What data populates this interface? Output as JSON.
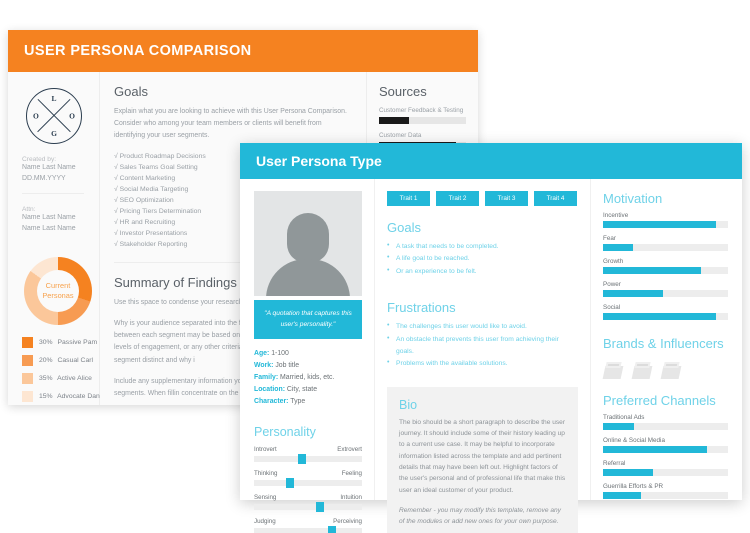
{
  "left_doc": {
    "header_title": "USER PERSONA COMPARISON",
    "logo": {
      "letters": [
        "L",
        "O",
        "G",
        "O"
      ]
    },
    "created_by_label": "Created by:",
    "created_by_name": "Name Last Name",
    "created_by_date": "DD.MM.YYYY",
    "attn_label": "Attn:",
    "attn_name_1": "Name Last Name",
    "attn_name_2": "Name Last Name",
    "donut": {
      "center_line_1": "Current",
      "center_line_2": "Personas",
      "legend": [
        {
          "percent": "30%",
          "name": "Passive Pam",
          "color": "#F58220"
        },
        {
          "percent": "20%",
          "name": "Casual Carl",
          "color": "#F79B52"
        },
        {
          "percent": "35%",
          "name": "Active Alice",
          "color": "#FBC79A"
        },
        {
          "percent": "15%",
          "name": "Advocate Dan",
          "color": "#FDE6D2"
        }
      ]
    },
    "goals": {
      "heading": "Goals",
      "body": "Explain what you are looking to achieve with this User Persona Comparison. Consider who among your team members or clients will benefit from identifying your user segments.",
      "checklist": [
        "√ Product Roadmap Decisions",
        "√ Sales Teams Goal Setting",
        "√ Content Marketing",
        "√ Social Media Targeting",
        "√ SEO Optimization",
        "√ Pricing Tiers Determination",
        "√ HR and Recruiting",
        "√ Investor Presentations",
        "√ Stakeholder Reporting"
      ]
    },
    "summary": {
      "heading": "Summary of Findings",
      "para_1": "Use this space to condense your research and a                    summary.",
      "para_2": "Why is your audience separated into the followin high level differentiators between each segment may be based on: demographics, psychographic levels of engagement, or any other criteria speci industry. How is each segment distinct and why i",
      "para_3": "Include any supplementary information you feel understand your customer segments. When fillin concentrate on the unique characteristics betwe"
    },
    "sources": {
      "heading": "Sources",
      "items": [
        {
          "label": "Customer Feedback & Testing",
          "value": 34
        },
        {
          "label": "Customer Data",
          "value": 88
        }
      ]
    }
  },
  "right_card": {
    "header_title": "User Persona Type",
    "quote": "\"A quotation that captures this user's personality.\"",
    "details": [
      {
        "key": "Age:",
        "value": " 1-100"
      },
      {
        "key": "Work:",
        "value": " Job title"
      },
      {
        "key": "Family:",
        "value": " Married, kids, etc."
      },
      {
        "key": "Location:",
        "value": " City, state"
      },
      {
        "key": "Character:",
        "value": " Type"
      }
    ],
    "personality": {
      "heading": "Personality",
      "sliders": [
        {
          "left": "Introvert",
          "right": "Extrovert",
          "position": 44
        },
        {
          "left": "Thinking",
          "right": "Feeling",
          "position": 33
        },
        {
          "left": "Sensing",
          "right": "Intuition",
          "position": 61
        },
        {
          "left": "Judging",
          "right": "Perceiving",
          "position": 72
        }
      ]
    },
    "traits": [
      "Trait 1",
      "Trait 2",
      "Trait 3",
      "Trait 4"
    ],
    "goals": {
      "heading": "Goals",
      "items": [
        "A task that needs to be completed.",
        "A life goal to be reached.",
        "Or an experience to be felt."
      ]
    },
    "frustrations": {
      "heading": "Frustrations",
      "items": [
        "The challenges this user would like to avoid.",
        "An obstacle that prevents this user from achieving their goals.",
        "Problems with the available solutions."
      ]
    },
    "bio": {
      "heading": "Bio",
      "body": "The bio should be a short paragraph to describe the user journey. It should include some of their history leading up to a current use case. It may be helpful to incorporate information listed across the template and add pertinent details that may have been left out. Highlight factors of the user's personal and of professional life that make this user an ideal customer of your product.",
      "note": "Remember - you may modify this template, remove any of the modules or add new ones for your own purpose."
    },
    "motivation": {
      "heading": "Motivation",
      "items": [
        {
          "label": "Incentive",
          "value": 90
        },
        {
          "label": "Fear",
          "value": 24
        },
        {
          "label": "Growth",
          "value": 78
        },
        {
          "label": "Power",
          "value": 48
        },
        {
          "label": "Social",
          "value": 90
        }
      ]
    },
    "brands": {
      "heading": "Brands & Influencers",
      "icon_count": 3
    },
    "channels": {
      "heading": "Preferred Channels",
      "items": [
        {
          "label": "Traditional Ads",
          "value": 25
        },
        {
          "label": "Online & Social Media",
          "value": 83
        },
        {
          "label": "Referral",
          "value": 40
        },
        {
          "label": "Guerrilla Efforts & PR",
          "value": 30
        }
      ]
    }
  },
  "colors": {
    "orange": "#F58220",
    "teal": "#22B8D8",
    "teal_light": "#6FD2E8"
  }
}
